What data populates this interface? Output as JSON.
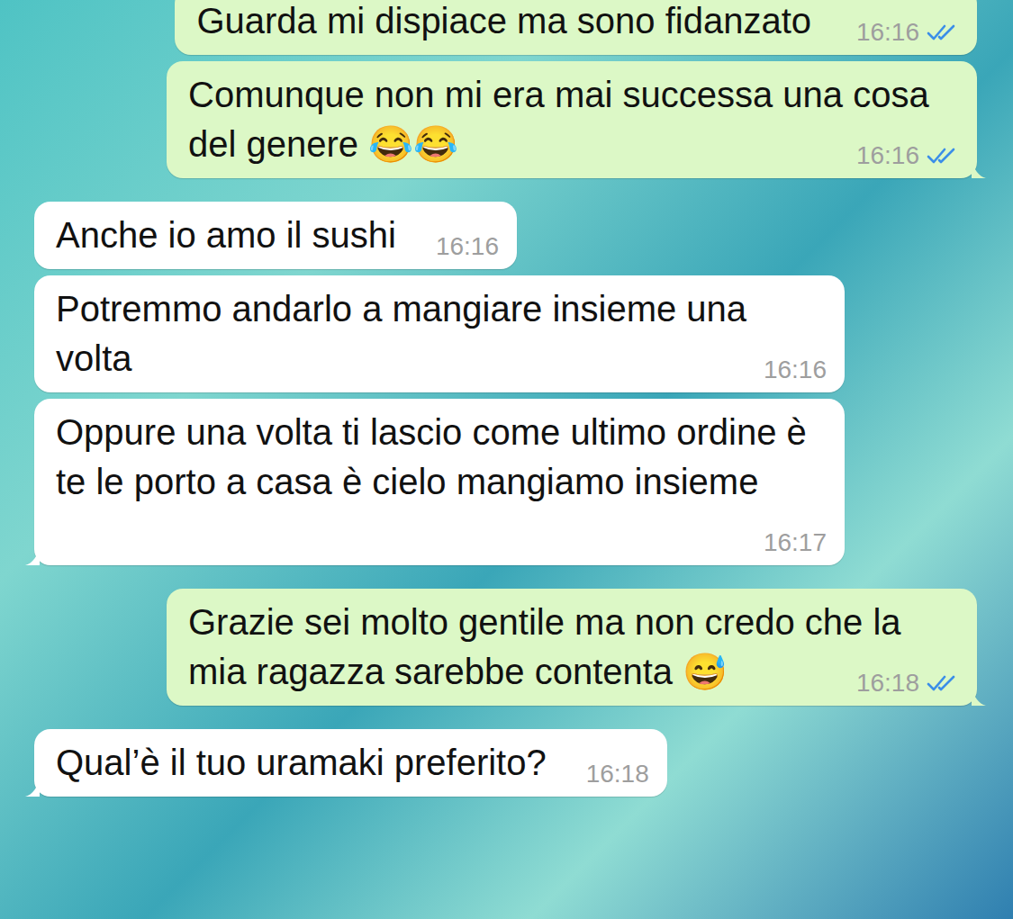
{
  "chat": {
    "messages": [
      {
        "text": "Guarda mi dispiace ma sono fidanzato",
        "time": "16:16",
        "outgoing": true,
        "read": true,
        "tail": false
      },
      {
        "text": "Comunque non mi era mai successa una cosa del genere 😂😂",
        "time": "16:16",
        "outgoing": true,
        "read": true,
        "tail": true
      },
      {
        "text": "Anche io amo il sushi",
        "time": "16:16",
        "outgoing": false,
        "tail": false
      },
      {
        "text": "Potremmo andarlo a mangiare insieme una volta",
        "time": "16:16",
        "outgoing": false,
        "tail": false
      },
      {
        "text": "Oppure una volta ti lascio come ultimo ordine è te le porto a casa è cielo mangiamo insieme",
        "time": "16:17",
        "outgoing": false,
        "tail": true
      },
      {
        "text": "Grazie sei molto gentile ma non credo che la mia ragazza sarebbe contenta 😅",
        "time": "16:18",
        "outgoing": true,
        "read": true,
        "tail": true
      },
      {
        "text": "Qual’è il tuo uramaki preferito?",
        "time": "16:18",
        "outgoing": false,
        "tail": true
      }
    ]
  }
}
